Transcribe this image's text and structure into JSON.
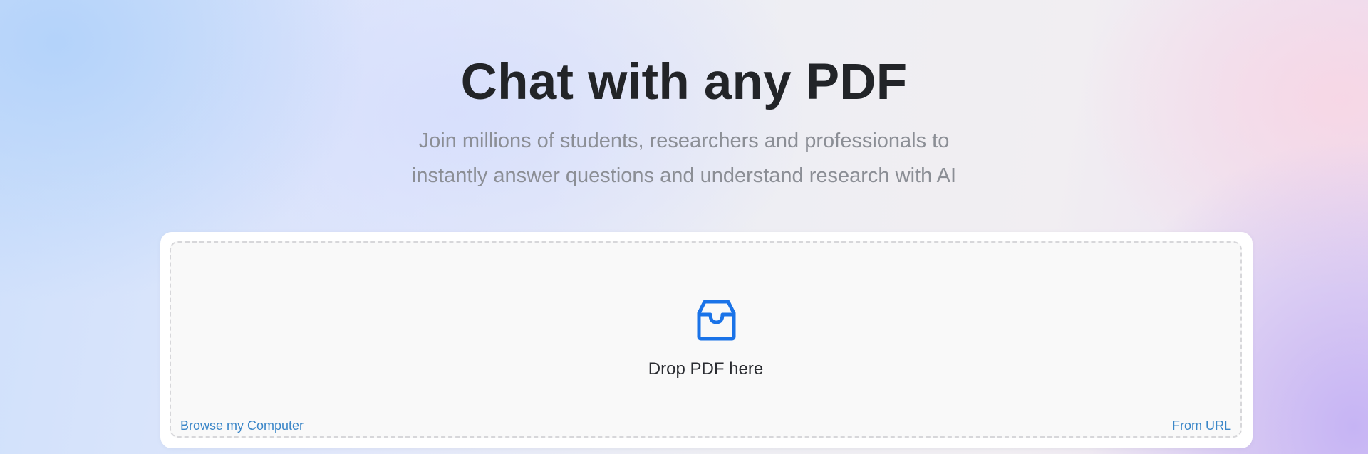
{
  "hero": {
    "title": "Chat with any PDF",
    "subtitle": "Join millions of students, researchers and professionals to instantly answer questions and understand research with AI"
  },
  "uploader": {
    "icon": "inbox-icon",
    "drop_label": "Drop PDF here",
    "browse_label": "Browse my Computer",
    "url_label": "From URL",
    "accent_color": "#1a73e8",
    "link_color": "#3a86c8"
  }
}
